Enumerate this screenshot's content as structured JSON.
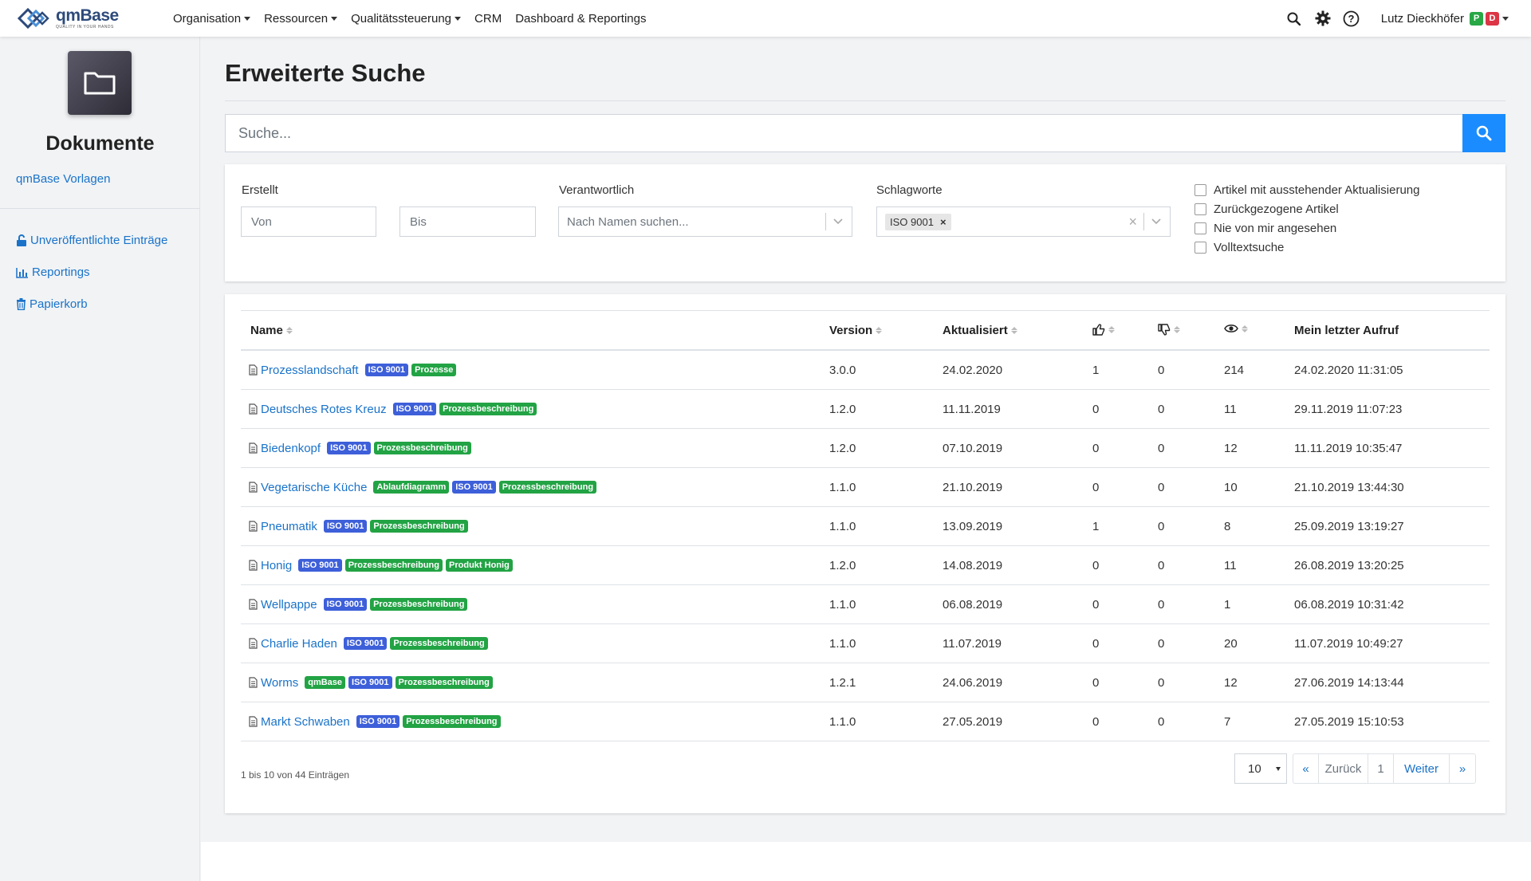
{
  "app": {
    "logo_name": "qmBase",
    "logo_tagline": "QUALITY IN YOUR HANDS"
  },
  "nav": {
    "items": [
      {
        "label": "Organisation",
        "dropdown": true
      },
      {
        "label": "Ressourcen",
        "dropdown": true
      },
      {
        "label": "Qualitätssteuerung",
        "dropdown": true
      },
      {
        "label": "CRM",
        "dropdown": false
      },
      {
        "label": "Dashboard & Reportings",
        "dropdown": false
      }
    ],
    "icons": [
      "search-icon",
      "gear-icon",
      "help-circle-icon"
    ],
    "user": {
      "name": "Lutz Dieckhöfer",
      "badge1": "P",
      "badge1_color": "#28a745",
      "badge2": "D",
      "badge2_color": "#dc3545"
    }
  },
  "sidebar": {
    "title": "Dokumente",
    "subtitle": "qmBase Vorlagen",
    "links": [
      {
        "label": "Unveröffentlichte Einträge",
        "icon": "lock-open-icon"
      },
      {
        "label": "Reportings",
        "icon": "bar-chart-icon"
      },
      {
        "label": "Papierkorb",
        "icon": "trash-icon"
      }
    ]
  },
  "main": {
    "title": "Erweiterte Suche",
    "search_placeholder": "Suche..."
  },
  "filters": {
    "created_label": "Erstellt",
    "from_placeholder": "Von",
    "to_placeholder": "Bis",
    "responsible_label": "Verantwortlich",
    "responsible_placeholder": "Nach Namen suchen...",
    "keywords_label": "Schlagworte",
    "keyword_chip": "ISO 9001",
    "checkboxes": [
      "Artikel mit ausstehender Aktualisierung",
      "Zurückgezogene Artikel",
      "Nie von mir angesehen",
      "Volltextsuche"
    ]
  },
  "table": {
    "headers": {
      "name": "Name",
      "version": "Version",
      "updated": "Aktualisiert",
      "last_view": "Mein letzter Aufruf"
    },
    "rows": [
      {
        "name": "Prozesslandschaft",
        "tags": [
          [
            "ISO 9001",
            "iso"
          ],
          [
            "Prozesse",
            "green"
          ]
        ],
        "version": "3.0.0",
        "updated": "24.02.2020",
        "likes": "1",
        "dislikes": "0",
        "views": "214",
        "last": "24.02.2020 11:31:05"
      },
      {
        "name": "Deutsches Rotes Kreuz",
        "tags": [
          [
            "ISO 9001",
            "iso"
          ],
          [
            "Prozessbeschreibung",
            "green"
          ]
        ],
        "version": "1.2.0",
        "updated": "11.11.2019",
        "likes": "0",
        "dislikes": "0",
        "views": "11",
        "last": "29.11.2019 11:07:23"
      },
      {
        "name": "Biedenkopf",
        "tags": [
          [
            "ISO 9001",
            "iso"
          ],
          [
            "Prozessbeschreibung",
            "green"
          ]
        ],
        "version": "1.2.0",
        "updated": "07.10.2019",
        "likes": "0",
        "dislikes": "0",
        "views": "12",
        "last": "11.11.2019 10:35:47"
      },
      {
        "name": "Vegetarische Küche",
        "tags": [
          [
            "Ablaufdiagramm",
            "green"
          ],
          [
            "ISO 9001",
            "iso"
          ],
          [
            "Prozessbeschreibung",
            "green"
          ]
        ],
        "version": "1.1.0",
        "updated": "21.10.2019",
        "likes": "0",
        "dislikes": "0",
        "views": "10",
        "last": "21.10.2019 13:44:30"
      },
      {
        "name": "Pneumatik",
        "tags": [
          [
            "ISO 9001",
            "iso"
          ],
          [
            "Prozessbeschreibung",
            "green"
          ]
        ],
        "version": "1.1.0",
        "updated": "13.09.2019",
        "likes": "1",
        "dislikes": "0",
        "views": "8",
        "last": "25.09.2019 13:19:27"
      },
      {
        "name": "Honig",
        "tags": [
          [
            "ISO 9001",
            "iso"
          ],
          [
            "Prozessbeschreibung",
            "green"
          ],
          [
            "Produkt Honig",
            "green"
          ]
        ],
        "version": "1.2.0",
        "updated": "14.08.2019",
        "likes": "0",
        "dislikes": "0",
        "views": "11",
        "last": "26.08.2019 13:20:25"
      },
      {
        "name": "Wellpappe",
        "tags": [
          [
            "ISO 9001",
            "iso"
          ],
          [
            "Prozessbeschreibung",
            "green"
          ]
        ],
        "version": "1.1.0",
        "updated": "06.08.2019",
        "likes": "0",
        "dislikes": "0",
        "views": "1",
        "last": "06.08.2019 10:31:42"
      },
      {
        "name": "Charlie Haden",
        "tags": [
          [
            "ISO 9001",
            "iso"
          ],
          [
            "Prozessbeschreibung",
            "green"
          ]
        ],
        "version": "1.1.0",
        "updated": "11.07.2019",
        "likes": "0",
        "dislikes": "0",
        "views": "20",
        "last": "11.07.2019 10:49:27"
      },
      {
        "name": "Worms",
        "tags": [
          [
            "qmBase",
            "green"
          ],
          [
            "ISO 9001",
            "iso"
          ],
          [
            "Prozessbeschreibung",
            "green"
          ]
        ],
        "version": "1.2.1",
        "updated": "24.06.2019",
        "likes": "0",
        "dislikes": "0",
        "views": "12",
        "last": "27.06.2019 14:13:44"
      },
      {
        "name": "Markt Schwaben",
        "tags": [
          [
            "ISO 9001",
            "iso"
          ],
          [
            "Prozessbeschreibung",
            "green"
          ]
        ],
        "version": "1.1.0",
        "updated": "27.05.2019",
        "likes": "0",
        "dislikes": "0",
        "views": "7",
        "last": "27.05.2019 15:10:53"
      }
    ],
    "info": "1 bis 10 von 44 Einträgen",
    "page_size": "10",
    "pager": {
      "first": "«",
      "prev": "Zurück",
      "current": "1",
      "next": "Weiter",
      "last": "»"
    }
  },
  "colors": {
    "accent": "#1a8cff",
    "link": "#1a73c9",
    "iso_badge": "#3d5fd9",
    "green_badge": "#22a344"
  }
}
